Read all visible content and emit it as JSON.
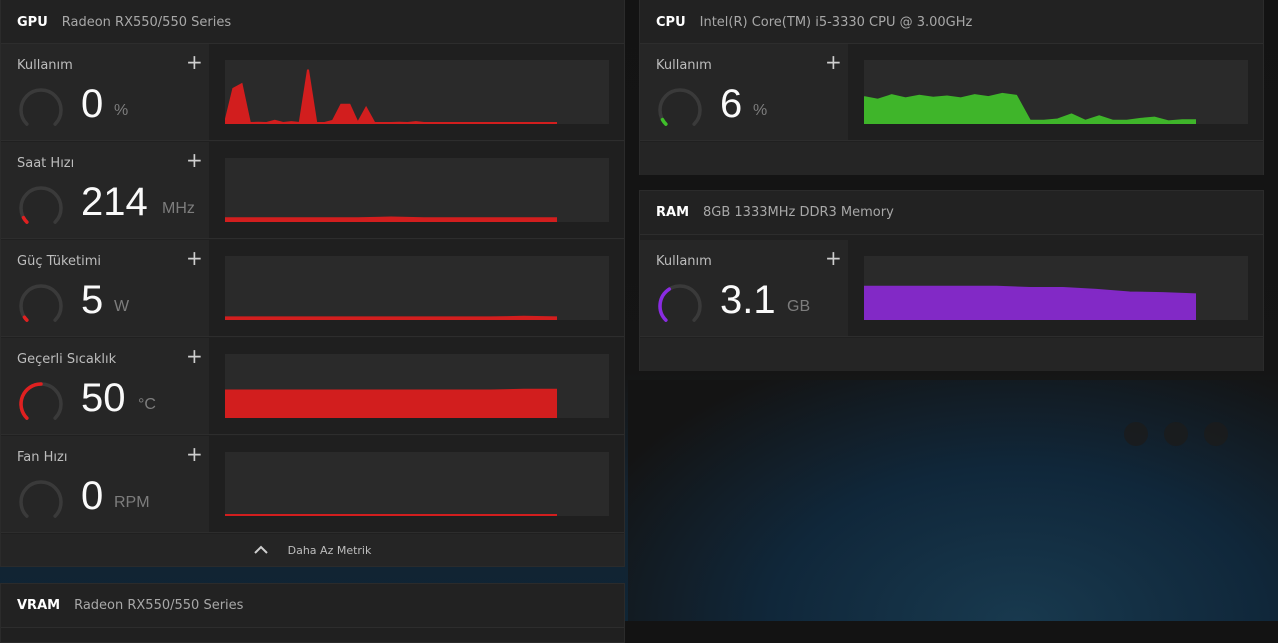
{
  "gpu": {
    "title": "GPU",
    "subtitle": "Radeon RX550/550 Series",
    "metrics": [
      {
        "label": "Kullanım",
        "value": "0",
        "unit": "%",
        "gauge_fraction": 0.0,
        "gauge_color": "#e02020"
      },
      {
        "label": "Saat Hızı",
        "value": "214",
        "unit": "MHz",
        "gauge_fraction": 0.06,
        "gauge_color": "#e02020"
      },
      {
        "label": "Güç Tüketimi",
        "value": "5",
        "unit": "W",
        "gauge_fraction": 0.04,
        "gauge_color": "#e02020"
      },
      {
        "label": "Geçerli Sıcaklık",
        "value": "50",
        "unit": "°C",
        "gauge_fraction": 0.5,
        "gauge_color": "#e02020"
      },
      {
        "label": "Fan Hızı",
        "value": "0",
        "unit": "RPM",
        "gauge_fraction": 0.0,
        "gauge_color": "#e02020"
      }
    ],
    "footer_label": "Daha Az Metrik"
  },
  "vram": {
    "title": "VRAM",
    "subtitle": "Radeon RX550/550 Series"
  },
  "cpu": {
    "title": "CPU",
    "subtitle": "Intel(R) Core(TM) i5-3330 CPU @ 3.00GHz",
    "metric": {
      "label": "Kullanım",
      "value": "6",
      "unit": "%",
      "gauge_fraction": 0.06,
      "gauge_color": "#3fbf2a"
    }
  },
  "ram": {
    "title": "RAM",
    "subtitle": "8GB 1333MHz DDR3 Memory",
    "metric": {
      "label": "Kullanım",
      "value": "3.1",
      "unit": "GB",
      "gauge_fraction": 0.38,
      "gauge_color": "#8a2be2"
    }
  },
  "icons": {
    "plus": "+",
    "chevron_up": "︿"
  },
  "colors": {
    "gpu": "#d21e1e",
    "cpu": "#3fb52a",
    "ram": "#8229c6"
  },
  "chart_data": [
    {
      "type": "area",
      "name": "gpu-usage",
      "x": [
        0,
        1,
        2,
        3,
        4,
        5,
        6,
        7,
        8,
        9,
        10,
        11,
        12,
        13,
        14,
        15,
        16,
        17,
        18,
        19,
        20,
        21,
        22,
        23,
        24,
        25,
        26,
        27,
        28,
        29,
        30,
        31,
        32,
        33,
        34,
        35,
        36,
        37,
        38,
        39,
        40
      ],
      "values": [
        0,
        55,
        62,
        0,
        2,
        0,
        5,
        0,
        3,
        0,
        85,
        0,
        0,
        5,
        30,
        30,
        0,
        25,
        0,
        0,
        0,
        2,
        0,
        3,
        0,
        0,
        0,
        0,
        0,
        0,
        0,
        0,
        0,
        0,
        0,
        0,
        0,
        0,
        0,
        0,
        0
      ],
      "ylim": [
        0,
        100
      ],
      "color": "#d21e1e"
    },
    {
      "type": "area",
      "name": "gpu-clock",
      "x": [
        0,
        1,
        2,
        3,
        4,
        5,
        6,
        7,
        8,
        9,
        10
      ],
      "values": [
        6,
        6,
        6,
        6,
        6,
        7,
        6,
        6,
        6,
        6,
        6
      ],
      "ylim": [
        0,
        100
      ],
      "color": "#d21e1e"
    },
    {
      "type": "area",
      "name": "gpu-power",
      "x": [
        0,
        1,
        2,
        3,
        4,
        5,
        6,
        7,
        8,
        9,
        10
      ],
      "values": [
        4,
        4,
        4,
        4,
        4,
        4,
        4,
        4,
        4,
        5,
        4
      ],
      "ylim": [
        0,
        100
      ],
      "color": "#d21e1e"
    },
    {
      "type": "area",
      "name": "gpu-temp",
      "x": [
        0,
        1,
        2,
        3,
        4,
        5,
        6,
        7,
        8,
        9,
        10
      ],
      "values": [
        43,
        43,
        43,
        43,
        43,
        43,
        43,
        43,
        43,
        44,
        44
      ],
      "ylim": [
        0,
        100
      ],
      "color": "#d21e1e"
    },
    {
      "type": "area",
      "name": "gpu-fan",
      "x": [
        0,
        1,
        2,
        3,
        4,
        5,
        6,
        7,
        8,
        9,
        10
      ],
      "values": [
        1,
        1,
        1,
        1,
        1,
        1,
        1,
        1,
        1,
        1,
        1
      ],
      "ylim": [
        0,
        100
      ],
      "color": "#d21e1e"
    },
    {
      "type": "area",
      "name": "cpu-usage",
      "x": [
        0,
        1,
        2,
        3,
        4,
        5,
        6,
        7,
        8,
        9,
        10,
        11,
        12,
        13,
        14,
        15,
        16,
        17,
        18,
        19,
        20,
        21,
        22,
        23,
        24
      ],
      "values": [
        42,
        38,
        45,
        40,
        44,
        41,
        43,
        40,
        45,
        42,
        47,
        44,
        5,
        5,
        7,
        15,
        5,
        12,
        5,
        5,
        8,
        10,
        4,
        6,
        6
      ],
      "ylim": [
        0,
        100
      ],
      "color": "#3fb52a"
    },
    {
      "type": "area",
      "name": "ram-usage",
      "x": [
        0,
        1,
        2,
        3,
        4,
        5,
        6,
        7,
        8,
        9,
        10
      ],
      "values": [
        52,
        52,
        52,
        52,
        52,
        50,
        50,
        47,
        43,
        42,
        40
      ],
      "ylim": [
        0,
        100
      ],
      "color": "#8229c6"
    }
  ]
}
